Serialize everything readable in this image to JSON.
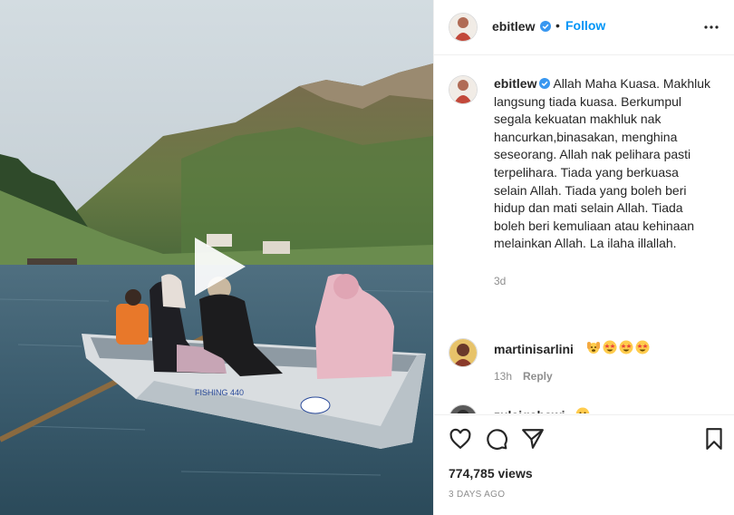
{
  "post": {
    "username": "ebitlew",
    "follow_label": "Follow",
    "separator": "•",
    "caption": "Allah Maha Kuasa. Makhluk langsung tiada kuasa. Berkumpul segala kekuatan makhluk nak hancurkan,binasakan, menghina seseorang. Allah nak pelihara pasti terpelihara. Tiada yang berkuasa selain Allah. Tiada yang boleh beri hidup dan mati selain Allah. Tiada boleh beri kemuliaan atau kehinaan melainkan Allah. La ilaha illallah.",
    "caption_age": "3d",
    "views": "774,785 views",
    "posted_ago": "3 DAYS AGO"
  },
  "comments": [
    {
      "username": "martinisarlini",
      "emojis": [
        "raising-hands-emoji",
        "star-struck-emoji",
        "star-struck-emoji",
        "star-struck-emoji"
      ],
      "time": "13h",
      "reply_label": "Reply"
    },
    {
      "username": "zulaiqahawi",
      "emojis": [
        "smiling-emoji"
      ]
    }
  ],
  "icons": {
    "verified": "verified-badge-icon",
    "more": "more-options-icon",
    "like": "heart-icon",
    "comment": "comment-icon",
    "share": "share-icon",
    "save": "bookmark-icon",
    "play": "play-icon"
  },
  "colors": {
    "link_blue": "#0095f6",
    "text": "#262626",
    "muted": "#8e8e8e",
    "border": "#efefef"
  }
}
